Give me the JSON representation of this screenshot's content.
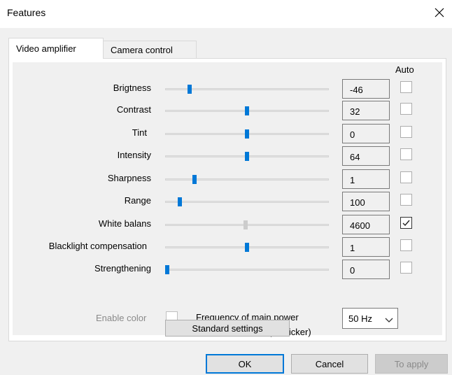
{
  "window": {
    "title": "Features"
  },
  "tabs": [
    {
      "label": "Video amplifier",
      "active": true
    },
    {
      "label": "Camera control",
      "active": false
    }
  ],
  "auto_header": "Auto",
  "rows": [
    {
      "label": "Brigtness",
      "value": "-46",
      "slider_fraction": 0.14,
      "auto": false,
      "enabled": true
    },
    {
      "label": "Contrast",
      "value": "32",
      "slider_fraction": 0.5,
      "auto": false,
      "enabled": true
    },
    {
      "label": "Tint",
      "value": "0",
      "slider_fraction": 0.5,
      "auto": false,
      "enabled": true
    },
    {
      "label": "Intensity",
      "value": "64",
      "slider_fraction": 0.5,
      "auto": false,
      "enabled": true
    },
    {
      "label": "Sharpness",
      "value": "1",
      "slider_fraction": 0.17,
      "auto": false,
      "enabled": true
    },
    {
      "label": "Range",
      "value": "100",
      "slider_fraction": 0.08,
      "auto": false,
      "enabled": true
    },
    {
      "label": "White balans",
      "value": "4600",
      "slider_fraction": 0.49,
      "auto": true,
      "enabled": false
    },
    {
      "label": "Blacklight compensation",
      "value": "1",
      "slider_fraction": 0.5,
      "auto": false,
      "enabled": true
    },
    {
      "label": "Strengthening",
      "value": "0",
      "slider_fraction": 0.0,
      "auto": false,
      "enabled": true
    }
  ],
  "enable_color": {
    "label": "Enable color",
    "checked": false
  },
  "frequency": {
    "label_line1": "Frequency of main power",
    "label_line2": "(no flicker)",
    "selected": "50 Hz"
  },
  "standard_settings_label": "Standard settings",
  "buttons": {
    "ok": "OK",
    "cancel": "Cancel",
    "apply": "To apply"
  },
  "colors": {
    "accent": "#0078d7",
    "background": "#f0f0f0"
  }
}
